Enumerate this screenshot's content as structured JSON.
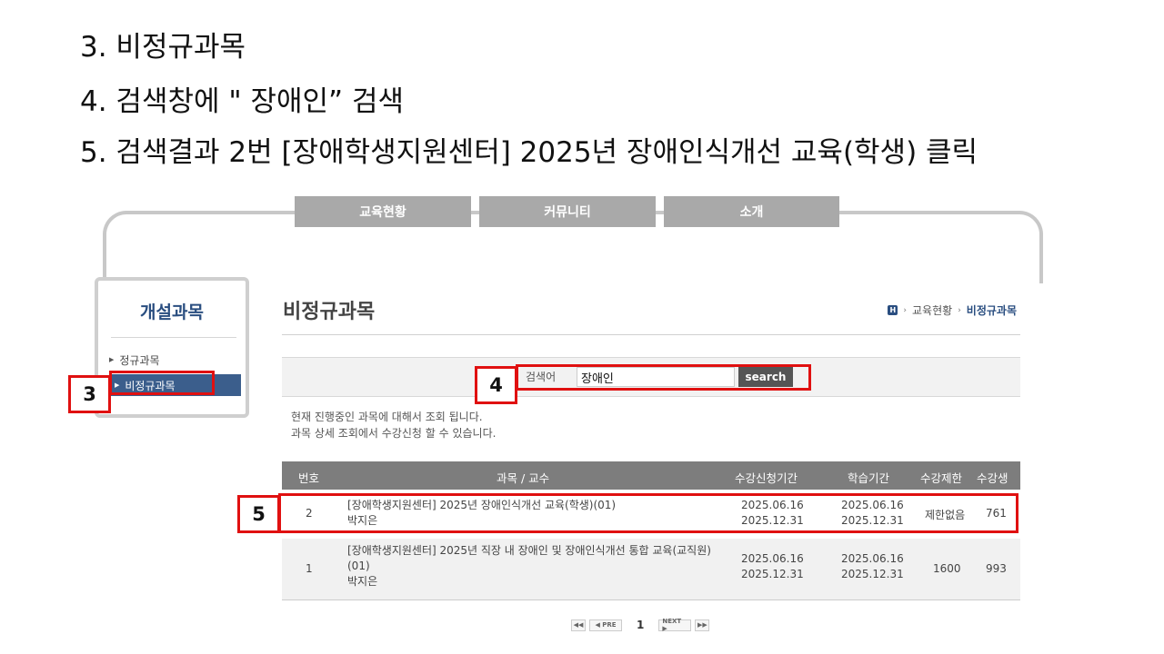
{
  "instructions": [
    "3. 비정규과목",
    "4. 검색창에  \" 장애인” 검색",
    "5. 검색결과 2번 [장애학생지원센터] 2025년 장애인식개선 교육(학생) 클릭"
  ],
  "topnav": [
    "교육현황",
    "커뮤니티",
    "소개"
  ],
  "sidebar": {
    "title": "개설과목",
    "items": [
      {
        "label": "정규과목"
      },
      {
        "label": "비정규과목"
      }
    ]
  },
  "page": {
    "title": "비정규과목",
    "breadcrumb": {
      "home_icon": "H",
      "parent": "교육현황",
      "current": "비정규과목"
    }
  },
  "search": {
    "label": "검색어",
    "value": "장애인",
    "button": "search"
  },
  "notice": [
    "현재 진행중인 과목에 대해서 조회 됩니다.",
    "과목 상세 조회에서 수강신청 할 수 있습니다."
  ],
  "table": {
    "headers": [
      "번호",
      "과목 / 교수",
      "수강신청기간",
      "학습기간",
      "수강제한",
      "수강생"
    ],
    "rows": [
      {
        "no": "2",
        "course": "[장애학생지원센터] 2025년 장애인식개선 교육(학생)(01)",
        "professor": "박지은",
        "reg_start": "2025.06.16",
        "reg_end": "2025.12.31",
        "study_start": "2025.06.16",
        "study_end": "2025.12.31",
        "limit": "제한없음",
        "count": "761"
      },
      {
        "no": "1",
        "course": "[장애학생지원센터] 2025년 직장 내 장애인 및 장애인식개선 통합 교육(교직원)(01)",
        "professor": "박지은",
        "reg_start": "2025.06.16",
        "reg_end": "2025.12.31",
        "study_start": "2025.06.16",
        "study_end": "2025.12.31",
        "limit": "1600",
        "count": "993"
      }
    ]
  },
  "pager": {
    "first": "◀◀",
    "prev": "◀ PRE",
    "page": "1",
    "next": "NEXT ▶",
    "last": "▶▶"
  },
  "annotations": [
    "3",
    "4",
    "5"
  ],
  "colors": {
    "annotation_red": "#e01010",
    "sidebar_active": "#3b5e8c",
    "table_header": "#7d7d7d",
    "tab": "#a9a9a9"
  }
}
